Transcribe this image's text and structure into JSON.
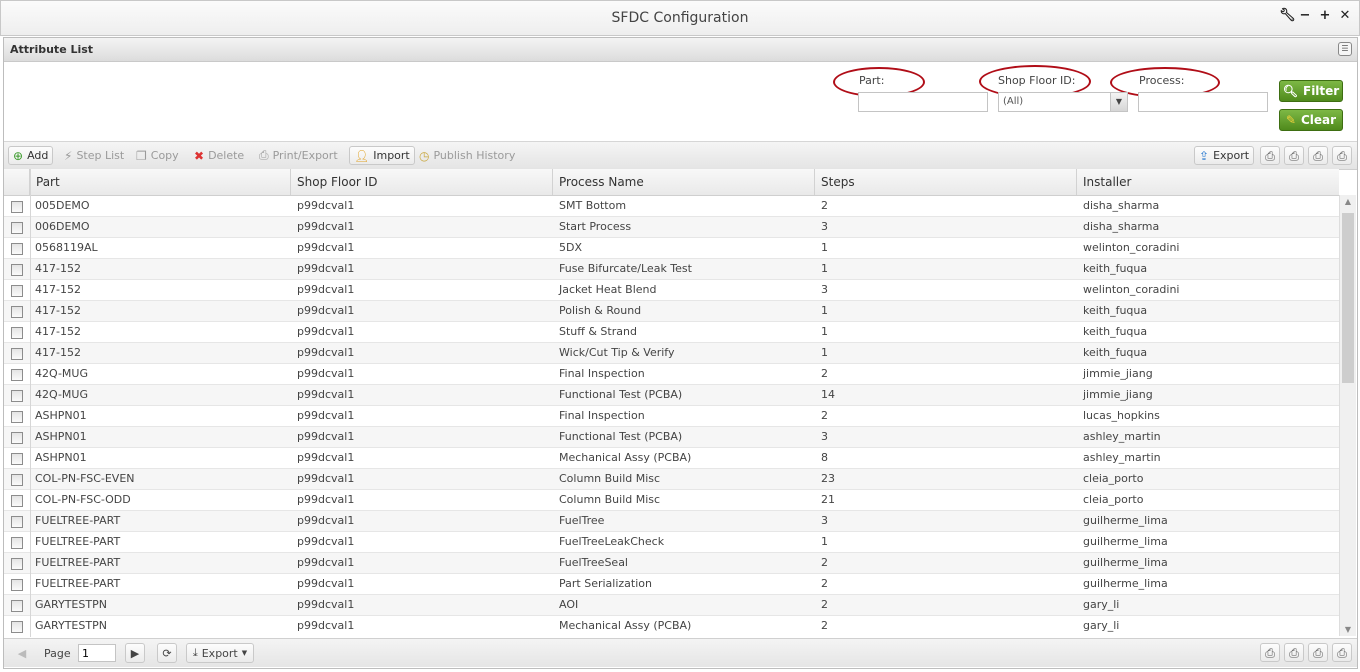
{
  "window": {
    "title": "SFDC Configuration",
    "controls": [
      {
        "name": "wrench-icon",
        "glyph": "🔧"
      },
      {
        "name": "minimize-icon",
        "glyph": "−"
      },
      {
        "name": "maximize-icon",
        "glyph": "+"
      },
      {
        "name": "close-icon",
        "glyph": "✕"
      }
    ]
  },
  "panel": {
    "title": "Attribute List",
    "settings_icon": "column-chooser-icon"
  },
  "filter": {
    "part_label": "Part:",
    "part_value": "",
    "shop_floor_label": "Shop Floor ID:",
    "shop_floor_value": "(All)",
    "process_label": "Process:",
    "process_value": "",
    "filter_button": "Filter",
    "clear_button": "Clear",
    "highlight_color": "#b00d17",
    "button_color": "#5d9a26"
  },
  "toolbar": {
    "add": "Add",
    "step_list": "Step List",
    "copy": "Copy",
    "delete": "Delete",
    "print_export": "Print/Export",
    "import": "Import",
    "publish_history": "Publish History",
    "export": "Export"
  },
  "grid": {
    "columns": [
      "Part",
      "Shop Floor ID",
      "Process Name",
      "Steps",
      "Installer"
    ],
    "rows": [
      [
        "005DEMO",
        "p99dcval1",
        "SMT Bottom",
        "2",
        "disha_sharma"
      ],
      [
        "006DEMO",
        "p99dcval1",
        "Start Process",
        "3",
        "disha_sharma"
      ],
      [
        "0568119AL",
        "p99dcval1",
        "5DX",
        "1",
        "welinton_coradini"
      ],
      [
        "417-152",
        "p99dcval1",
        "Fuse Bifurcate/Leak Test",
        "1",
        "keith_fuqua"
      ],
      [
        "417-152",
        "p99dcval1",
        "Jacket Heat Blend",
        "3",
        "welinton_coradini"
      ],
      [
        "417-152",
        "p99dcval1",
        "Polish & Round",
        "1",
        "keith_fuqua"
      ],
      [
        "417-152",
        "p99dcval1",
        "Stuff & Strand",
        "1",
        "keith_fuqua"
      ],
      [
        "417-152",
        "p99dcval1",
        "Wick/Cut Tip & Verify",
        "1",
        "keith_fuqua"
      ],
      [
        "42Q-MUG",
        "p99dcval1",
        "Final Inspection",
        "2",
        "jimmie_jiang"
      ],
      [
        "42Q-MUG",
        "p99dcval1",
        "Functional Test (PCBA)",
        "14",
        "jimmie_jiang"
      ],
      [
        "ASHPN01",
        "p99dcval1",
        "Final Inspection",
        "2",
        "lucas_hopkins"
      ],
      [
        "ASHPN01",
        "p99dcval1",
        "Functional Test (PCBA)",
        "3",
        "ashley_martin"
      ],
      [
        "ASHPN01",
        "p99dcval1",
        "Mechanical Assy (PCBA)",
        "8",
        "ashley_martin"
      ],
      [
        "COL-PN-FSC-EVEN",
        "p99dcval1",
        "Column Build Misc",
        "23",
        "cleia_porto"
      ],
      [
        "COL-PN-FSC-ODD",
        "p99dcval1",
        "Column Build Misc",
        "21",
        "cleia_porto"
      ],
      [
        "FUELTREE-PART",
        "p99dcval1",
        "FuelTree",
        "3",
        "guilherme_lima"
      ],
      [
        "FUELTREE-PART",
        "p99dcval1",
        "FuelTreeLeakCheck",
        "1",
        "guilherme_lima"
      ],
      [
        "FUELTREE-PART",
        "p99dcval1",
        "FuelTreeSeal",
        "2",
        "guilherme_lima"
      ],
      [
        "FUELTREE-PART",
        "p99dcval1",
        "Part Serialization",
        "2",
        "guilherme_lima"
      ],
      [
        "GARYTESTPN",
        "p99dcval1",
        "AOI",
        "2",
        "gary_li"
      ],
      [
        "GARYTESTPN",
        "p99dcval1",
        "Mechanical Assy (PCBA)",
        "2",
        "gary_li"
      ]
    ]
  },
  "pager": {
    "page_label": "Page",
    "page_value": "1",
    "export": "Export"
  }
}
